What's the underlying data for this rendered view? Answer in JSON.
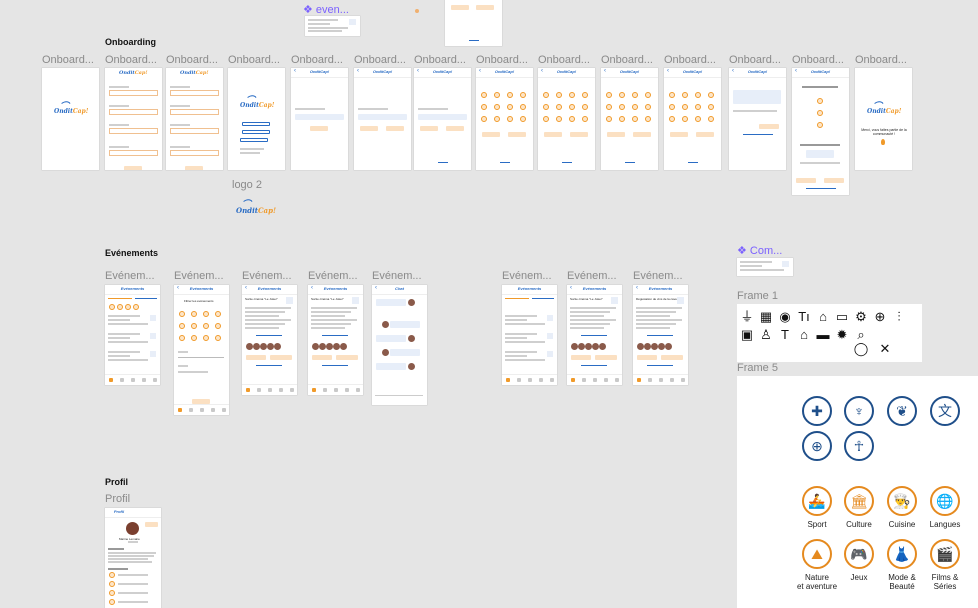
{
  "canvas": {
    "top_component_label": "❖ even...",
    "sections": {
      "onboarding": "Onboarding",
      "evenements": "Evénements",
      "profil": "Profil"
    },
    "onboarding_frame_labels": [
      "Onboard...",
      "Onboard...",
      "Onboard...",
      "Onboard...",
      "Onboard...",
      "Onboard...",
      "Onboard...",
      "Onboard...",
      "Onboard...",
      "Onboard...",
      "Onboard...",
      "Onboard...",
      "Onboard...",
      "Onboard..."
    ],
    "logo2_label": "logo 2",
    "evenements_frame_labels": [
      "Evénem...",
      "Evénem...",
      "Evénem...",
      "Evénem...",
      "Evénem...",
      "Evénem...",
      "Evénem...",
      "Evénem..."
    ],
    "profil_frame_label": "Profil",
    "component_label": "❖ Com...",
    "frame1_label": "Frame 1",
    "frame5_label": "Frame 5"
  },
  "app": {
    "logo_text_1": "Ondit",
    "logo_text_2": "Cap!",
    "header_title": "Evénements",
    "chat_title": "Chat",
    "profil_title": "Profil",
    "profil_name": "Marine Lemaire",
    "event_title": "Sortie cinéma \"Le Joker\"",
    "event_title_2": "Dégustation de vins de la cave",
    "filter_title": "Filtrer les événements",
    "thanks": "Merci, vous faites partie de la communauté !"
  },
  "frame5": {
    "categories": [
      {
        "label": "Sport",
        "icon": "sport-icon",
        "glyph": "🚣"
      },
      {
        "label": "Culture",
        "icon": "culture-icon",
        "glyph": "🏛"
      },
      {
        "label": "Cuisine",
        "icon": "cuisine-icon",
        "glyph": "👨‍🍳"
      },
      {
        "label": "Langues",
        "icon": "langues-icon",
        "glyph": "🌐"
      },
      {
        "label": "Nature\net aventure",
        "icon": "nature-icon",
        "glyph": "⛰"
      },
      {
        "label": "Jeux",
        "icon": "jeux-icon",
        "glyph": "🎮"
      },
      {
        "label": "Mode &\nBeauté",
        "icon": "mode-icon",
        "glyph": "👗"
      },
      {
        "label": "Films &\nSéries",
        "icon": "films-icon",
        "glyph": "🎬"
      }
    ],
    "blue_icons": [
      {
        "icon": "puzzle-icon",
        "glyph": "✚"
      },
      {
        "icon": "grass-icon",
        "glyph": "♆"
      },
      {
        "icon": "sprout-icon",
        "glyph": "❦"
      },
      {
        "icon": "translate-icon",
        "glyph": "文"
      },
      {
        "icon": "gamepad-icon",
        "glyph": "⊕"
      },
      {
        "icon": "meditation-icon",
        "glyph": "☥"
      }
    ]
  },
  "frame1_icons": [
    {
      "icon": "filter-icon",
      "glyph": "⏚"
    },
    {
      "icon": "calendar-icon",
      "glyph": "▦"
    },
    {
      "icon": "user-circle-icon",
      "glyph": "◉"
    },
    {
      "icon": "text-size-icon",
      "glyph": "Tı"
    },
    {
      "icon": "home-icon",
      "glyph": "⌂"
    },
    {
      "icon": "chat-icon",
      "glyph": "▭"
    },
    {
      "icon": "gear-icon",
      "glyph": "⚙"
    },
    {
      "icon": "zoom-in-icon",
      "glyph": "⊕"
    },
    {
      "icon": "sliders-icon",
      "glyph": "⫶"
    },
    {
      "icon": "calendar-check-icon",
      "glyph": "▣"
    },
    {
      "icon": "user-icon",
      "glyph": "♙"
    },
    {
      "icon": "text-icon",
      "glyph": "T"
    },
    {
      "icon": "home-filled-icon",
      "glyph": "⌂"
    },
    {
      "icon": "chat-filled-icon",
      "glyph": "▬"
    },
    {
      "icon": "gear-filled-icon",
      "glyph": "✹"
    },
    {
      "icon": "search-icon",
      "glyph": "⌕"
    },
    {
      "icon": "chat-bubble-icon",
      "glyph": "◯"
    },
    {
      "icon": "tools-icon",
      "glyph": "✕"
    }
  ]
}
